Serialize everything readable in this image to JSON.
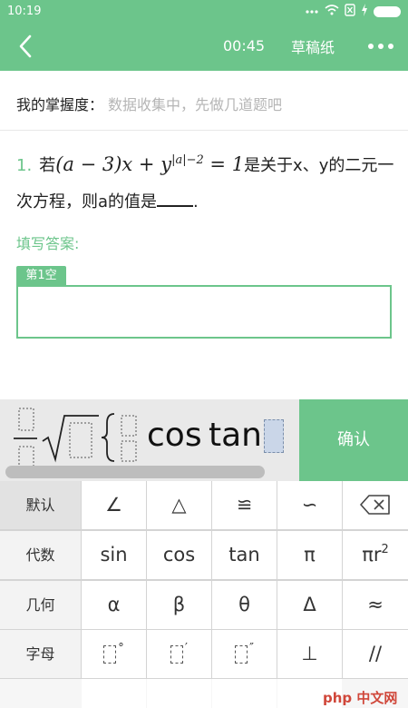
{
  "status_bar": {
    "time": "10:19",
    "icons": [
      "signal-icon",
      "wifi-icon",
      "no-sim-icon",
      "charging-icon",
      "battery-icon"
    ]
  },
  "nav": {
    "timer": "00:45",
    "draft_label": "草稿纸"
  },
  "mastery": {
    "label": "我的掌握度：",
    "value": "数据收集中，先做几道题吧"
  },
  "question": {
    "number": "1.",
    "prefix": "若",
    "math_open": "(a − 3)x + y",
    "exponent": "|a|−2",
    "math_close": " = 1",
    "text_tail": "是关于x、y的二元一次方程，则a的值是",
    "ending": "."
  },
  "answer": {
    "label": "填写答案:",
    "blank_tab": "第1空",
    "value": ""
  },
  "math_input": {
    "cos": "cos",
    "tan": "tan",
    "confirm_label": "确认"
  },
  "keyboard": {
    "categories": [
      "默认",
      "代数",
      "几何",
      "字母"
    ],
    "selected_category": "默认",
    "rows": [
      [
        "∠",
        "△",
        "≌",
        "∽",
        "⌫"
      ],
      [
        "sin",
        "cos",
        "tan",
        "π",
        "πr²"
      ],
      [
        "α",
        "β",
        "θ",
        "Δ",
        "≈"
      ],
      [
        "□°",
        "□′",
        "□″",
        "⊥",
        "//"
      ]
    ],
    "pi_r2_base": "πr",
    "pi_r2_sup": "2",
    "degree_sup": "°",
    "minute_sup": "′",
    "second_sup": "″"
  },
  "watermark": "php 中文网",
  "colors": {
    "accent": "#6cc58b",
    "hint_text": "#b5b5b5",
    "keyboard_bg": "#d4d4d4"
  }
}
